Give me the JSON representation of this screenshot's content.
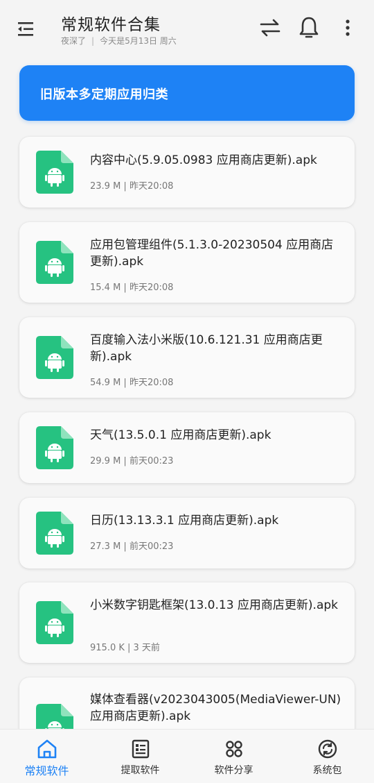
{
  "header": {
    "title": "常规软件合集",
    "greeting": "夜深了",
    "separator": "|",
    "date_text": "今天是5月13日 周六"
  },
  "banner": {
    "label": "旧版本多定期应用归类"
  },
  "files": [
    {
      "name": "内容中心(5.9.05.0983 应用商店更新).apk",
      "meta": "23.9 M | 昨天20:08"
    },
    {
      "name": "应用包管理组件(5.1.3.0-20230504 应用商店更新).apk",
      "meta": "15.4 M | 昨天20:08"
    },
    {
      "name": "百度输入法小米版(10.6.121.31 应用商店更新).apk",
      "meta": "54.9 M | 昨天20:08"
    },
    {
      "name": "天气(13.5.0.1 应用商店更新).apk",
      "meta": "29.9 M | 前天00:23"
    },
    {
      "name": "日历(13.13.3.1 应用商店更新).apk",
      "meta": "27.3 M | 前天00:23"
    },
    {
      "name": "小米数字钥匙框架(13.0.13 应用商店更新).apk",
      "meta": "915.0 K | 3 天前"
    },
    {
      "name": "媒体查看器(v2023043005(MediaViewer-UN) 应用商店更新).apk",
      "meta": ""
    }
  ],
  "nav": {
    "items": [
      {
        "label": "常规软件",
        "icon": "home-icon",
        "active": true
      },
      {
        "label": "提取软件",
        "icon": "list-doc-icon",
        "active": false
      },
      {
        "label": "软件分享",
        "icon": "grid-dots-icon",
        "active": false
      },
      {
        "label": "系统包",
        "icon": "refresh-circle-icon",
        "active": false
      }
    ]
  },
  "colors": {
    "accent": "#1e82f5",
    "apk_icon": "#26c281",
    "background": "#f4f4f4"
  }
}
